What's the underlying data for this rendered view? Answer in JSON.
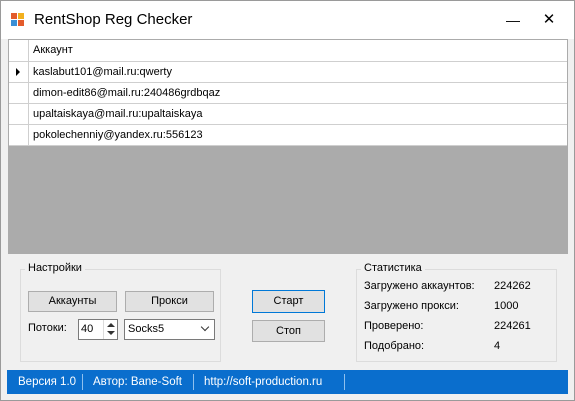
{
  "window": {
    "title": "RentShop Reg Checker",
    "minimize_glyph": "—",
    "close_glyph": "✕",
    "icon_name": "app-icon"
  },
  "grid": {
    "column_header": "Аккаунт",
    "rows": [
      {
        "value": "kaslabut101@mail.ru:qwerty",
        "current": true
      },
      {
        "value": "dimon-edit86@mail.ru:240486grdbqaz",
        "current": false
      },
      {
        "value": "upaltaiskaya@mail.ru:upaltaiskaya",
        "current": false
      },
      {
        "value": "pokolechenniy@yandex.ru:556123",
        "current": false
      }
    ]
  },
  "settings": {
    "title": "Настройки",
    "accounts_button": "Аккаунты",
    "proxy_button": "Прокси",
    "threads_label": "Потоки:",
    "threads_value": "40",
    "proxy_type_value": "Socks5"
  },
  "actions": {
    "start_button": "Старт",
    "stop_button": "Стоп"
  },
  "stats": {
    "title": "Статистика",
    "items": [
      {
        "label": "Загружено аккаунтов:",
        "value": "224262"
      },
      {
        "label": "Загружено прокси:",
        "value": "1000"
      },
      {
        "label": "Проверено:",
        "value": "224261"
      },
      {
        "label": "Подобрано:",
        "value": "4"
      }
    ]
  },
  "statusbar": {
    "version": "Версия 1.0",
    "author": "Автор: Bane-Soft",
    "url": "http://soft-production.ru"
  },
  "colors": {
    "accent": "#0a6ecd",
    "window_bg": "#f0f0f0",
    "grid_bg": "#ababab"
  }
}
